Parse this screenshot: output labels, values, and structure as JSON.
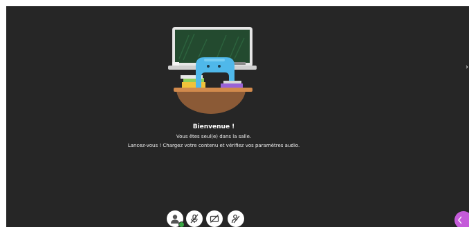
{
  "welcome": {
    "title": "Bienvenue !",
    "line1": "Vous êtes seul(e) dans la salle.",
    "line2": "Lancez-vous ! Chargez votre contenu et vérifiez vos paramètres audio."
  },
  "controls": {
    "avatar_icon": "user-avatar-icon",
    "avatar_status": "online",
    "microphone_icon": "microphone-muted-icon",
    "camera_icon": "camera-off-icon",
    "share_icon": "share-off-icon"
  },
  "side_panel": {
    "toggle_icon": "panel-toggle-icon",
    "color": "#c45bd9"
  },
  "colors": {
    "background": "#262626",
    "status_green": "#3aa645",
    "chalkboard": "#234a2f",
    "mascot_blue": "#4fb8ea"
  }
}
